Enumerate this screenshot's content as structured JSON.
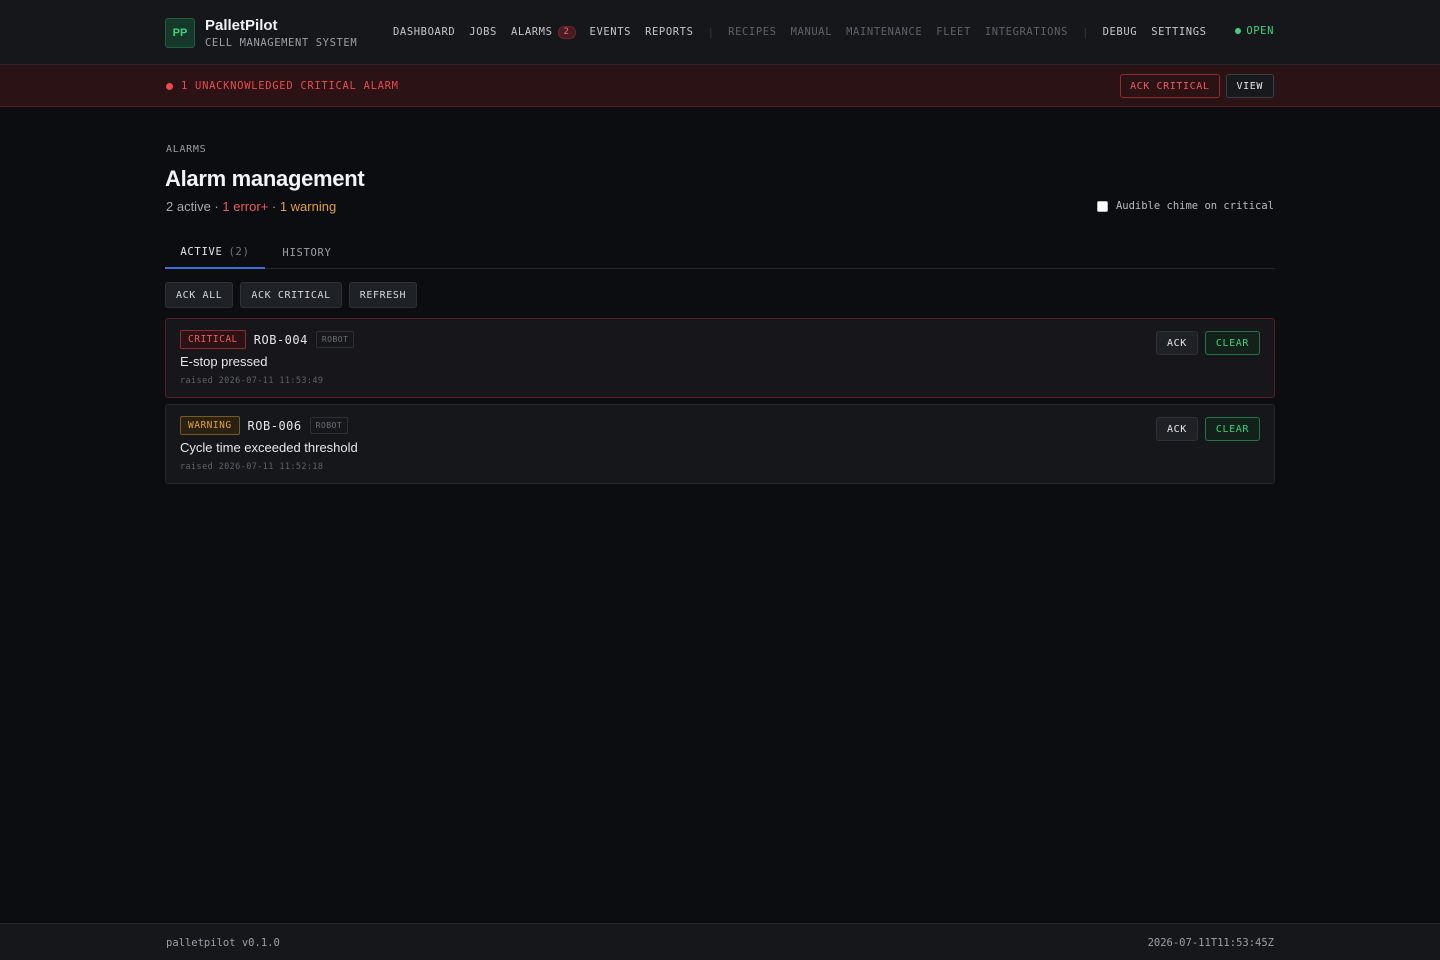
{
  "header": {
    "logo": "PP",
    "brand_name": "PalletPilot",
    "brand_subtitle": "CELL MANAGEMENT SYSTEM",
    "nav": {
      "dashboard": "DASHBOARD",
      "jobs": "JOBS",
      "alarms": "ALARMS",
      "alarms_badge": "2",
      "events": "EVENTS",
      "reports": "REPORTS",
      "recipes": "RECIPES",
      "manual": "MANUAL",
      "maintenance": "MAINTENANCE",
      "fleet": "FLEET",
      "integrations": "INTEGRATIONS",
      "debug": "DEBUG",
      "settings": "SETTINGS"
    },
    "status": "OPEN",
    "status_color": "#3fd07f"
  },
  "banner": {
    "text": "1 UNACKNOWLEDGED CRITICAL ALARM",
    "ack_critical_label": "ACK CRITICAL",
    "view_label": "VIEW"
  },
  "page": {
    "eyebrow": "ALARMS",
    "title": "Alarm management",
    "summary_active": "2 active",
    "summary_sep1": " · ",
    "summary_errors": "1 error+",
    "summary_sep2": " · ",
    "summary_warnings": "1 warning",
    "chime_label": "Audible chime on critical"
  },
  "tabs": {
    "active_label": "ACTIVE",
    "active_count": "(2)",
    "history_label": "HISTORY"
  },
  "actions": {
    "ack_all": "ACK ALL",
    "ack_critical": "ACK CRITICAL",
    "refresh": "REFRESH"
  },
  "alarms": [
    {
      "severity": "CRITICAL",
      "source": "ROB-004",
      "source_type": "ROBOT",
      "message": "E-stop pressed",
      "raised": "raised 2026-07-11 11:53:49",
      "ack_label": "ACK",
      "clear_label": "CLEAR"
    },
    {
      "severity": "WARNING",
      "source": "ROB-006",
      "source_type": "ROBOT",
      "message": "Cycle time exceeded threshold",
      "raised": "raised 2026-07-11 11:52:18",
      "ack_label": "ACK",
      "clear_label": "CLEAR"
    }
  ],
  "footer": {
    "version": "palletpilot v0.1.0",
    "timestamp": "2026-07-11T11:53:45Z"
  },
  "colors": {
    "critical": "#ef5a60",
    "warning": "#e0a23a",
    "ok": "#3fd07f",
    "accent": "#3b6fd6"
  }
}
